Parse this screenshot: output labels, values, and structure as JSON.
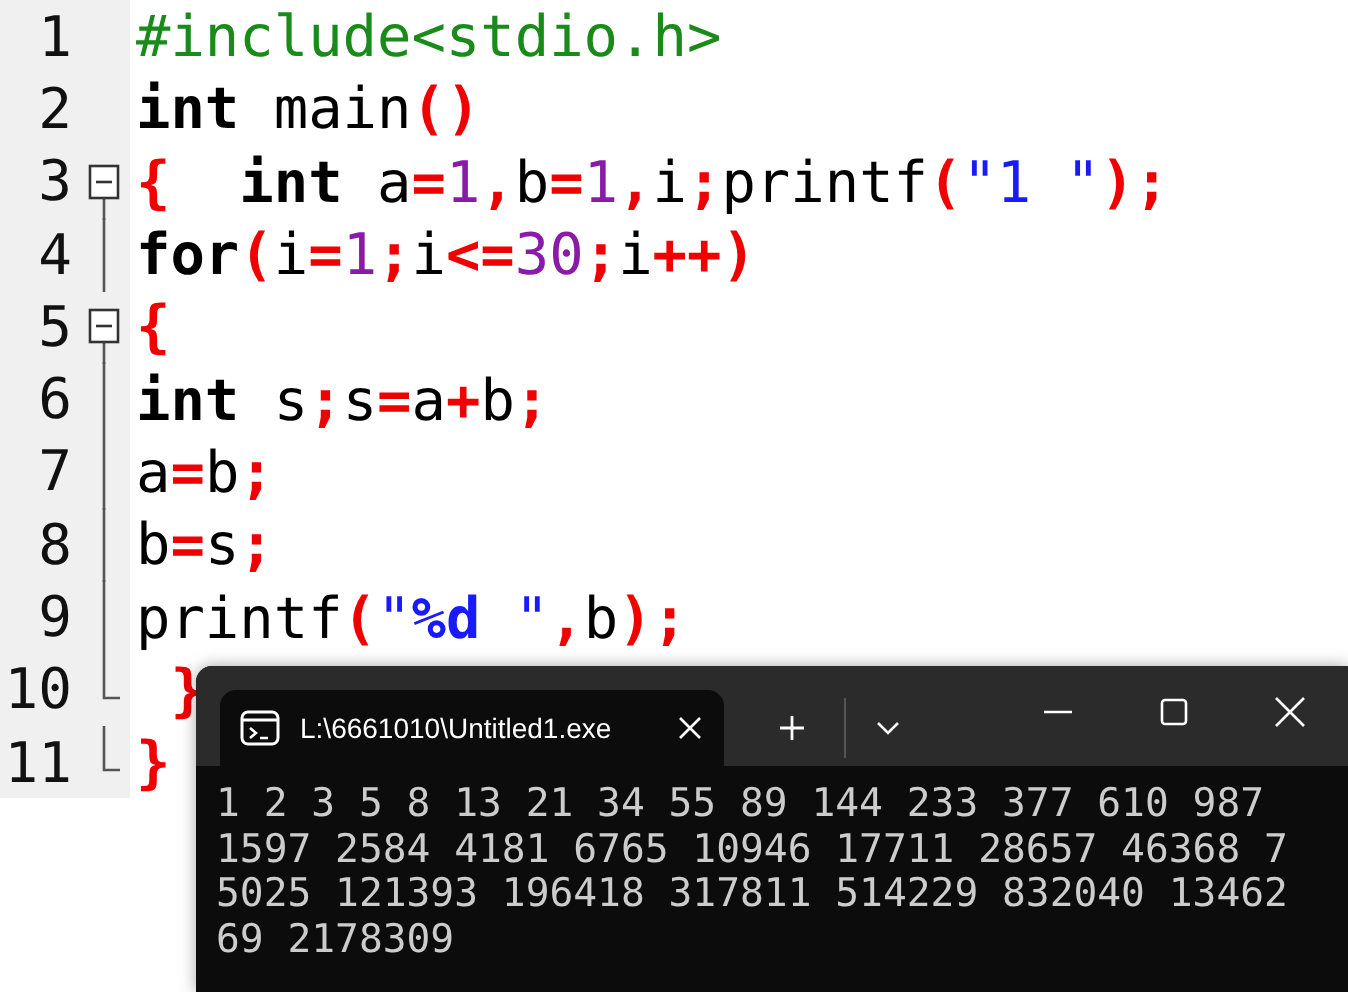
{
  "editor": {
    "lines": [
      {
        "number": "1",
        "tokens": [
          {
            "kind": "pre",
            "text": "#include<stdio.h>"
          }
        ]
      },
      {
        "number": "2",
        "tokens": [
          {
            "kind": "kw",
            "text": "int"
          },
          {
            "kind": "id",
            "text": " main"
          },
          {
            "kind": "op",
            "text": "()"
          }
        ]
      },
      {
        "number": "3",
        "fold": {
          "kind": "start",
          "expanded": true
        },
        "tokens": [
          {
            "kind": "op",
            "text": "{"
          },
          {
            "kind": "kw",
            "text": "  int"
          },
          {
            "kind": "id",
            "text": " a"
          },
          {
            "kind": "op",
            "text": "="
          },
          {
            "kind": "num",
            "text": "1"
          },
          {
            "kind": "op",
            "text": ","
          },
          {
            "kind": "id",
            "text": "b"
          },
          {
            "kind": "op",
            "text": "="
          },
          {
            "kind": "num",
            "text": "1"
          },
          {
            "kind": "op",
            "text": ","
          },
          {
            "kind": "id",
            "text": "i"
          },
          {
            "kind": "op",
            "text": ";"
          },
          {
            "kind": "id",
            "text": "printf"
          },
          {
            "kind": "op",
            "text": "("
          },
          {
            "kind": "str",
            "text": "\"1 \""
          },
          {
            "kind": "op",
            "text": ");"
          }
        ]
      },
      {
        "number": "4",
        "fold": {
          "kind": "line"
        },
        "tokens": [
          {
            "kind": "kw",
            "text": "for"
          },
          {
            "kind": "op",
            "text": "("
          },
          {
            "kind": "id",
            "text": "i"
          },
          {
            "kind": "op",
            "text": "="
          },
          {
            "kind": "num",
            "text": "1"
          },
          {
            "kind": "op",
            "text": ";"
          },
          {
            "kind": "id",
            "text": "i"
          },
          {
            "kind": "op",
            "text": "<="
          },
          {
            "kind": "num",
            "text": "30"
          },
          {
            "kind": "op",
            "text": ";"
          },
          {
            "kind": "id",
            "text": "i"
          },
          {
            "kind": "op",
            "text": "++)"
          }
        ]
      },
      {
        "number": "5",
        "fold": {
          "kind": "start",
          "expanded": true
        },
        "tokens": [
          {
            "kind": "op",
            "text": "{"
          }
        ]
      },
      {
        "number": "6",
        "fold": {
          "kind": "line"
        },
        "tokens": [
          {
            "kind": "kw",
            "text": "int"
          },
          {
            "kind": "id",
            "text": " s"
          },
          {
            "kind": "op",
            "text": ";"
          },
          {
            "kind": "id",
            "text": "s"
          },
          {
            "kind": "op",
            "text": "="
          },
          {
            "kind": "id",
            "text": "a"
          },
          {
            "kind": "op",
            "text": "+"
          },
          {
            "kind": "id",
            "text": "b"
          },
          {
            "kind": "op",
            "text": ";"
          }
        ]
      },
      {
        "number": "7",
        "fold": {
          "kind": "line"
        },
        "tokens": [
          {
            "kind": "id",
            "text": "a"
          },
          {
            "kind": "op",
            "text": "="
          },
          {
            "kind": "id",
            "text": "b"
          },
          {
            "kind": "op",
            "text": ";"
          }
        ]
      },
      {
        "number": "8",
        "fold": {
          "kind": "line"
        },
        "tokens": [
          {
            "kind": "id",
            "text": "b"
          },
          {
            "kind": "op",
            "text": "="
          },
          {
            "kind": "id",
            "text": "s"
          },
          {
            "kind": "op",
            "text": ";"
          }
        ]
      },
      {
        "number": "9",
        "fold": {
          "kind": "line"
        },
        "tokens": [
          {
            "kind": "id",
            "text": "printf"
          },
          {
            "kind": "op",
            "text": "("
          },
          {
            "kind": "str",
            "text": "\""
          },
          {
            "kind": "fmt",
            "text": "%d"
          },
          {
            "kind": "str",
            "text": " \""
          },
          {
            "kind": "op",
            "text": ","
          },
          {
            "kind": "id",
            "text": "b"
          },
          {
            "kind": "op",
            "text": ");"
          }
        ]
      },
      {
        "number": "10",
        "fold": {
          "kind": "end"
        },
        "tokens": [
          {
            "kind": "op",
            "text": " }"
          }
        ]
      },
      {
        "number": "11",
        "fold": {
          "kind": "end"
        },
        "tokens": [
          {
            "kind": "op",
            "text": "}"
          }
        ]
      }
    ]
  },
  "terminal": {
    "tab_title": "L:\\6661010\\Untitled1.exe",
    "output": [
      "1 2 3 5 8 13 21 34 55 89 144 233 377 610 987",
      "1597 2584 4181 6765 10946 17711 28657 46368 7",
      "5025 121393 196418 317811 514229 832040 13462",
      "69 2178309"
    ]
  }
}
